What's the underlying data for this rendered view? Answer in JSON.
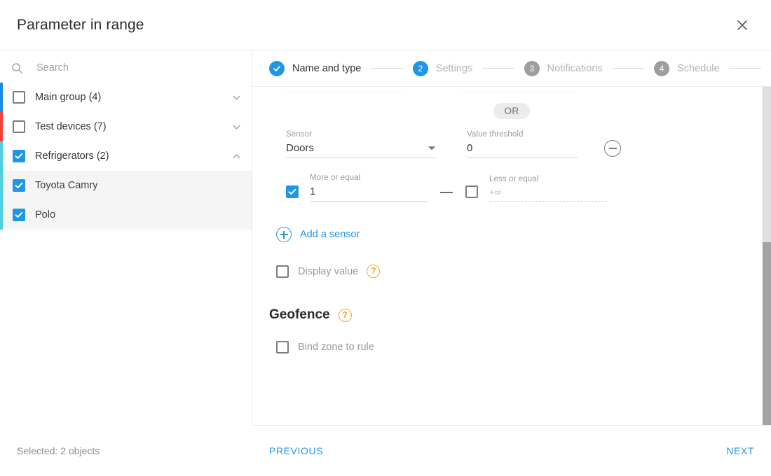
{
  "header": {
    "title": "Parameter in range",
    "close_icon": "close-icon"
  },
  "sidebar": {
    "search": {
      "placeholder": "Search",
      "value": "",
      "icon": "search-icon"
    },
    "tree": [
      {
        "label": "Main group (4)",
        "checked": false,
        "expanded": false,
        "color": "#1e88e5",
        "chevron": "chevron-down-icon"
      },
      {
        "label": "Test devices (7)",
        "checked": false,
        "expanded": false,
        "color": "#f44336",
        "chevron": "chevron-down-icon"
      },
      {
        "label": "Refrigerators (2)",
        "checked": true,
        "expanded": true,
        "color": "#4dd0e1",
        "chevron": "chevron-up-icon"
      }
    ],
    "children": [
      {
        "label": "Toyota Camry",
        "checked": true
      },
      {
        "label": "Polo",
        "checked": true
      }
    ]
  },
  "stepper": {
    "steps": [
      {
        "badge": "✓",
        "label": "Name and type",
        "state": "done"
      },
      {
        "badge": "2",
        "label": "Settings",
        "state": "active"
      },
      {
        "badge": "3",
        "label": "Notifications",
        "state": "todo"
      },
      {
        "badge": "4",
        "label": "Schedule",
        "state": "todo"
      }
    ]
  },
  "form": {
    "or_chip": "OR",
    "sensor": {
      "label": "Sensor",
      "value": "Doors",
      "caret_icon": "chevron-down-icon"
    },
    "threshold": {
      "label": "Value threshold",
      "value": "0"
    },
    "remove_sensor_icon": "minus-circle-icon",
    "more_or_equal": {
      "label": "More or equal",
      "value": "1",
      "checked": true
    },
    "less_or_equal": {
      "label": "Less or equal",
      "value": "+∞",
      "checked": false
    },
    "range_separator": "—",
    "add_sensor": {
      "label": "Add a sensor",
      "icon": "plus-circle-icon"
    },
    "display_value": {
      "label": "Display value",
      "checked": false,
      "help_icon": "question-circle-icon",
      "help_glyph": "?"
    },
    "geofence": {
      "title": "Geofence",
      "help_icon": "question-circle-icon",
      "help_glyph": "?",
      "bind_zone": {
        "label": "Bind zone to rule",
        "checked": false
      }
    }
  },
  "footer": {
    "selected_text": "Selected: 2 objects",
    "previous_label": "PREVIOUS",
    "next_label": "NEXT"
  },
  "colors": {
    "accent": "#2196e3",
    "help": "#f5a623",
    "muted": "#9e9e9e"
  }
}
